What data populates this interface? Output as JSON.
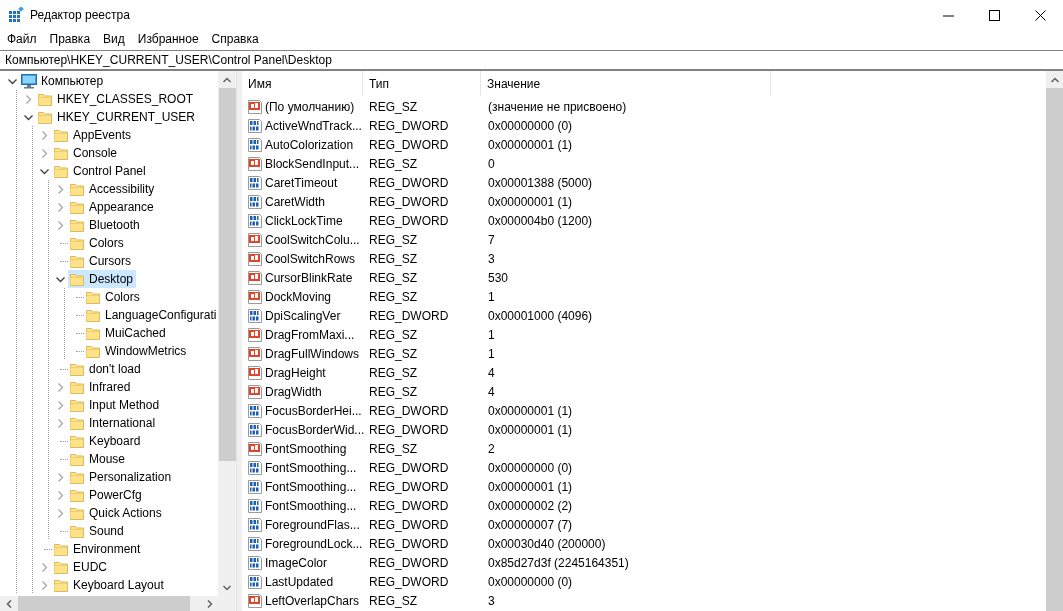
{
  "window": {
    "title": "Редактор реестра"
  },
  "menu": [
    "Файл",
    "Правка",
    "Вид",
    "Избранное",
    "Справка"
  ],
  "address": "Компьютер\\HKEY_CURRENT_USER\\Control Panel\\Desktop",
  "tree": [
    {
      "label": "Компьютер",
      "kind": "computer",
      "expanded": true,
      "selected": false,
      "children": [
        {
          "label": "HKEY_CLASSES_ROOT",
          "kind": "folder",
          "expanded": false,
          "selected": false
        },
        {
          "label": "HKEY_CURRENT_USER",
          "kind": "folder",
          "expanded": true,
          "selected": false,
          "children": [
            {
              "label": "AppEvents",
              "kind": "folder",
              "expanded": false,
              "selected": false
            },
            {
              "label": "Console",
              "kind": "folder",
              "expanded": false,
              "selected": false
            },
            {
              "label": "Control Panel",
              "kind": "folder",
              "expanded": true,
              "selected": false,
              "children": [
                {
                  "label": "Accessibility",
                  "kind": "folder",
                  "expanded": false,
                  "selected": false
                },
                {
                  "label": "Appearance",
                  "kind": "folder",
                  "expanded": false,
                  "selected": false
                },
                {
                  "label": "Bluetooth",
                  "kind": "folder",
                  "expanded": false,
                  "selected": false
                },
                {
                  "label": "Colors",
                  "kind": "folder",
                  "selected": false
                },
                {
                  "label": "Cursors",
                  "kind": "folder",
                  "selected": false
                },
                {
                  "label": "Desktop",
                  "kind": "folder",
                  "expanded": true,
                  "selected": true,
                  "children": [
                    {
                      "label": "Colors",
                      "kind": "folder",
                      "selected": false
                    },
                    {
                      "label": "LanguageConfigurati",
                      "kind": "folder",
                      "selected": false
                    },
                    {
                      "label": "MuiCached",
                      "kind": "folder",
                      "selected": false
                    },
                    {
                      "label": "WindowMetrics",
                      "kind": "folder",
                      "selected": false
                    }
                  ]
                },
                {
                  "label": "don't load",
                  "kind": "folder",
                  "selected": false
                },
                {
                  "label": "Infrared",
                  "kind": "folder",
                  "expanded": false,
                  "selected": false
                },
                {
                  "label": "Input Method",
                  "kind": "folder",
                  "expanded": false,
                  "selected": false
                },
                {
                  "label": "International",
                  "kind": "folder",
                  "expanded": false,
                  "selected": false
                },
                {
                  "label": "Keyboard",
                  "kind": "folder",
                  "selected": false
                },
                {
                  "label": "Mouse",
                  "kind": "folder",
                  "selected": false
                },
                {
                  "label": "Personalization",
                  "kind": "folder",
                  "expanded": false,
                  "selected": false
                },
                {
                  "label": "PowerCfg",
                  "kind": "folder",
                  "expanded": false,
                  "selected": false
                },
                {
                  "label": "Quick Actions",
                  "kind": "folder",
                  "expanded": false,
                  "selected": false
                },
                {
                  "label": "Sound",
                  "kind": "folder",
                  "selected": false
                }
              ]
            },
            {
              "label": "Environment",
              "kind": "folder",
              "selected": false
            },
            {
              "label": "EUDC",
              "kind": "folder",
              "expanded": false,
              "selected": false
            },
            {
              "label": "Keyboard Layout",
              "kind": "folder",
              "expanded": false,
              "selected": false
            }
          ]
        }
      ]
    }
  ],
  "list": {
    "columns": [
      "Имя",
      "Тип",
      "Значение"
    ],
    "rows": [
      {
        "kind": "string",
        "name": "(По умолчанию)",
        "type": "REG_SZ",
        "value": "(значение не присвоено)"
      },
      {
        "kind": "binary",
        "name": "ActiveWndTrack...",
        "type": "REG_DWORD",
        "value": "0x00000000 (0)"
      },
      {
        "kind": "binary",
        "name": "AutoColorization",
        "type": "REG_DWORD",
        "value": "0x00000001 (1)"
      },
      {
        "kind": "string",
        "name": "BlockSendInput...",
        "type": "REG_SZ",
        "value": "0"
      },
      {
        "kind": "binary",
        "name": "CaretTimeout",
        "type": "REG_DWORD",
        "value": "0x00001388 (5000)"
      },
      {
        "kind": "binary",
        "name": "CaretWidth",
        "type": "REG_DWORD",
        "value": "0x00000001 (1)"
      },
      {
        "kind": "binary",
        "name": "ClickLockTime",
        "type": "REG_DWORD",
        "value": "0x000004b0 (1200)"
      },
      {
        "kind": "string",
        "name": "CoolSwitchColu...",
        "type": "REG_SZ",
        "value": "7"
      },
      {
        "kind": "string",
        "name": "CoolSwitchRows",
        "type": "REG_SZ",
        "value": "3"
      },
      {
        "kind": "string",
        "name": "CursorBlinkRate",
        "type": "REG_SZ",
        "value": "530"
      },
      {
        "kind": "string",
        "name": "DockMoving",
        "type": "REG_SZ",
        "value": "1"
      },
      {
        "kind": "binary",
        "name": "DpiScalingVer",
        "type": "REG_DWORD",
        "value": "0x00001000 (4096)"
      },
      {
        "kind": "string",
        "name": "DragFromMaxi...",
        "type": "REG_SZ",
        "value": "1"
      },
      {
        "kind": "string",
        "name": "DragFullWindows",
        "type": "REG_SZ",
        "value": "1"
      },
      {
        "kind": "string",
        "name": "DragHeight",
        "type": "REG_SZ",
        "value": "4"
      },
      {
        "kind": "string",
        "name": "DragWidth",
        "type": "REG_SZ",
        "value": "4"
      },
      {
        "kind": "binary",
        "name": "FocusBorderHei...",
        "type": "REG_DWORD",
        "value": "0x00000001 (1)"
      },
      {
        "kind": "binary",
        "name": "FocusBorderWid...",
        "type": "REG_DWORD",
        "value": "0x00000001 (1)"
      },
      {
        "kind": "string",
        "name": "FontSmoothing",
        "type": "REG_SZ",
        "value": "2"
      },
      {
        "kind": "binary",
        "name": "FontSmoothing...",
        "type": "REG_DWORD",
        "value": "0x00000000 (0)"
      },
      {
        "kind": "binary",
        "name": "FontSmoothing...",
        "type": "REG_DWORD",
        "value": "0x00000001 (1)"
      },
      {
        "kind": "binary",
        "name": "FontSmoothing...",
        "type": "REG_DWORD",
        "value": "0x00000002 (2)"
      },
      {
        "kind": "binary",
        "name": "ForegroundFlas...",
        "type": "REG_DWORD",
        "value": "0x00000007 (7)"
      },
      {
        "kind": "binary",
        "name": "ForegroundLock...",
        "type": "REG_DWORD",
        "value": "0x00030d40 (200000)"
      },
      {
        "kind": "binary",
        "name": "ImageColor",
        "type": "REG_DWORD",
        "value": "0x85d27d3f (2245164351)"
      },
      {
        "kind": "binary",
        "name": "LastUpdated",
        "type": "REG_DWORD",
        "value": "0x00000000 (0)"
      },
      {
        "kind": "string",
        "name": "LeftOverlapChars",
        "type": "REG_SZ",
        "value": "3"
      }
    ]
  }
}
